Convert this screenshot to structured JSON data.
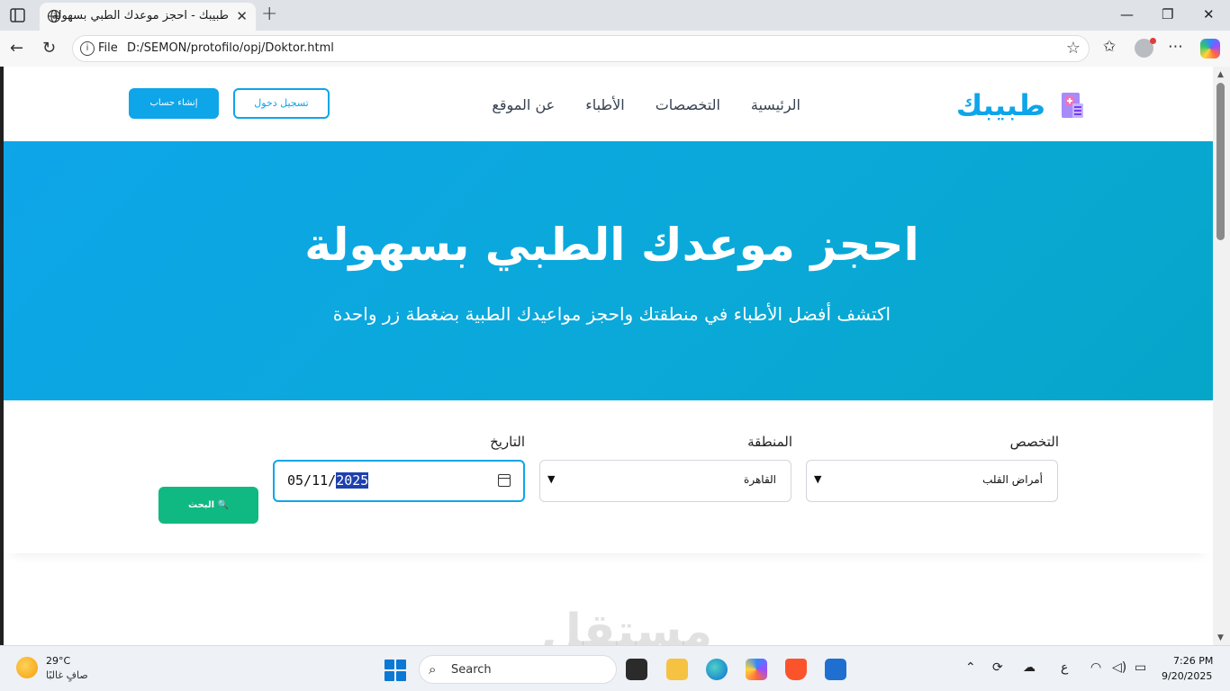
{
  "browser": {
    "tab_title": "طبيبك - احجز موعدك الطبي بسهولة",
    "close_tab": "✕",
    "new_tab": "+",
    "url_scheme": "File",
    "url": "D:/SEMON/protofilo/opj/Doktor.html",
    "window_controls": {
      "minimize": "—",
      "restore": "❐",
      "close": "✕"
    }
  },
  "site": {
    "logo_text": "طبيبك",
    "nav": [
      "الرئيسية",
      "التخصصات",
      "الأطباء",
      "عن الموقع"
    ],
    "login_label": "تسجيل دخول",
    "register_label": "إنشاء حساب",
    "accent_color": "#0ea5e9"
  },
  "hero": {
    "title": "احجز موعدك الطبي بسهولة",
    "subtitle": "اكتشف أفضل الأطباء في منطقتك واحجز مواعيدك الطبية بضغطة زر واحدة"
  },
  "search": {
    "specialty_label": "التخصص",
    "specialty_value": "أمراض القلب",
    "region_label": "المنطقة",
    "region_value": "القاهرة",
    "date_label": "التاريخ",
    "date_prefix": "05/11/",
    "date_year": "2025",
    "search_button": "🔍 البحث",
    "search_color": "#10b981"
  },
  "watermark": "مستقل",
  "taskbar": {
    "temperature": "29°C",
    "weather_desc": "صافٍ غالبًا",
    "search_placeholder": "Search",
    "language": "ع",
    "time": "7:26 PM",
    "date": "9/20/2025"
  }
}
